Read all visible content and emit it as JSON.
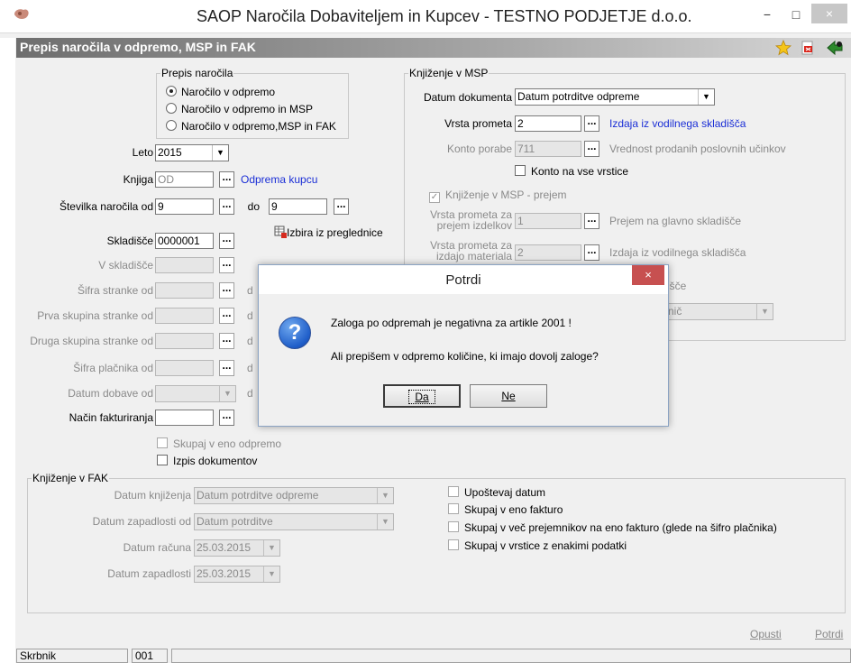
{
  "window": {
    "title": "SAOP  Naročila Dobaviteljem in Kupcev - TESTNO PODJETJE d.o.o.",
    "minimize": "−",
    "maximize": "□",
    "close": "×"
  },
  "form": {
    "title": "Prepis naročila v odpremo, MSP in FAK"
  },
  "prepis_group": {
    "legend": "Prepis naročila",
    "options": [
      {
        "label": "Naročilo v odpremo",
        "selected": true
      },
      {
        "label": "Naročilo v odpremo in MSP",
        "selected": false
      },
      {
        "label": "Naročilo v odpremo,MSP in FAK",
        "selected": false
      }
    ]
  },
  "left": {
    "leto_label": "Leto",
    "leto_value": "2015",
    "knjiga_label": "Knjiga",
    "knjiga_value": "OD",
    "knjiga_desc": "Odprema kupcu",
    "stevilka_label": "Številka naročila od",
    "stevilka_from": "9",
    "do_label": "do",
    "stevilka_to": "9",
    "izbira_label": "Izbira iz preglednice",
    "skladisce_label": "Skladišče",
    "skladisce_value": "0000001",
    "v_skladisce_label": "V skladišče",
    "sifra_stranke_label": "Šifra stranke od",
    "prva_skupina_label": "Prva skupina stranke od",
    "druga_skupina_label": "Druga skupina stranke od",
    "sifra_placnika_label": "Šifra plačnika od",
    "datum_dobave_label": "Datum dobave od",
    "nacin_label": "Način fakturiranja",
    "do_short": "d",
    "skupaj_odpremo": "Skupaj v eno odpremo",
    "izpis_dokumentov": "Izpis dokumentov"
  },
  "msp_group": {
    "legend": "Knjiženje v MSP",
    "datum_dok_label": "Datum dokumenta",
    "datum_dok_value": "Datum potrditve odpreme",
    "vrsta_label": "Vrsta prometa",
    "vrsta_value": "2",
    "vrsta_desc": "Izdaja iz vodilnega skladišča",
    "konto_label": "Konto porabe",
    "konto_value": "711",
    "konto_desc": "Vrednost prodanih poslovnih učinkov",
    "konto_vse": "Konto na vse vrstice",
    "knjizenje_prejem": "Knjiženje v MSP - prejem",
    "vrsta_izdelkov_label_1": "Vrsta prometa za",
    "vrsta_izdelkov_label_2": "prejem izdelkov",
    "vrsta_izdelkov_value": "1",
    "vrsta_izdelkov_desc": "Prejem na glavno skladišče",
    "vrsta_materiala_label_1": "Vrsta prometa za",
    "vrsta_materiala_label_2": "izdajo materiala",
    "vrsta_materiala_value": "2",
    "vrsta_materiala_desc": "Izdaja iz vodilnega skladišča",
    "partial_desc": "išče",
    "partial_combo": "nič"
  },
  "fak_group": {
    "legend": "Knjiženje v FAK",
    "datum_knjizenja_label": "Datum knjiženja",
    "datum_knjizenja_value": "Datum potrditve odpreme",
    "datum_zapadlosti_od_label": "Datum zapadlosti od",
    "datum_zapadlosti_od_value": "Datum potrditve",
    "datum_racuna_label": "Datum računa",
    "datum_racuna_value": "25.03.2015",
    "datum_zapadlosti_label": "Datum zapadlosti",
    "datum_zapadlosti_value": "25.03.2015",
    "upostevaj_datum": "Upoštevaj datum",
    "skupaj_fakturo": "Skupaj v eno fakturo",
    "skupaj_vec": "Skupaj v več prejemnikov na eno fakturo (glede na šifro plačnika)",
    "skupaj_vrstice": "Skupaj v vrstice z enakimi podatki"
  },
  "dialog": {
    "title": "Potrdi",
    "close": "×",
    "icon": "?",
    "message_1": "Zaloga po odpremah je negativna za artikle 2001 !",
    "message_2": "Ali prepišem v odpremo količine, ki imajo dovolj zaloge?",
    "yes": "Da",
    "no": "Ne"
  },
  "footer": {
    "opusti": "Opusti",
    "potrdi": "Potrdi"
  },
  "status": {
    "user": "Skrbnik",
    "code": "001"
  },
  "icons": {
    "app": "app-logo-icon",
    "favorite": "star-icon",
    "pdf": "pdf-icon",
    "exit": "exit-icon"
  },
  "colors": {
    "link": "#1a2ed6",
    "dialog_close": "#c75050",
    "disabled_text": "#8a8a8a"
  }
}
